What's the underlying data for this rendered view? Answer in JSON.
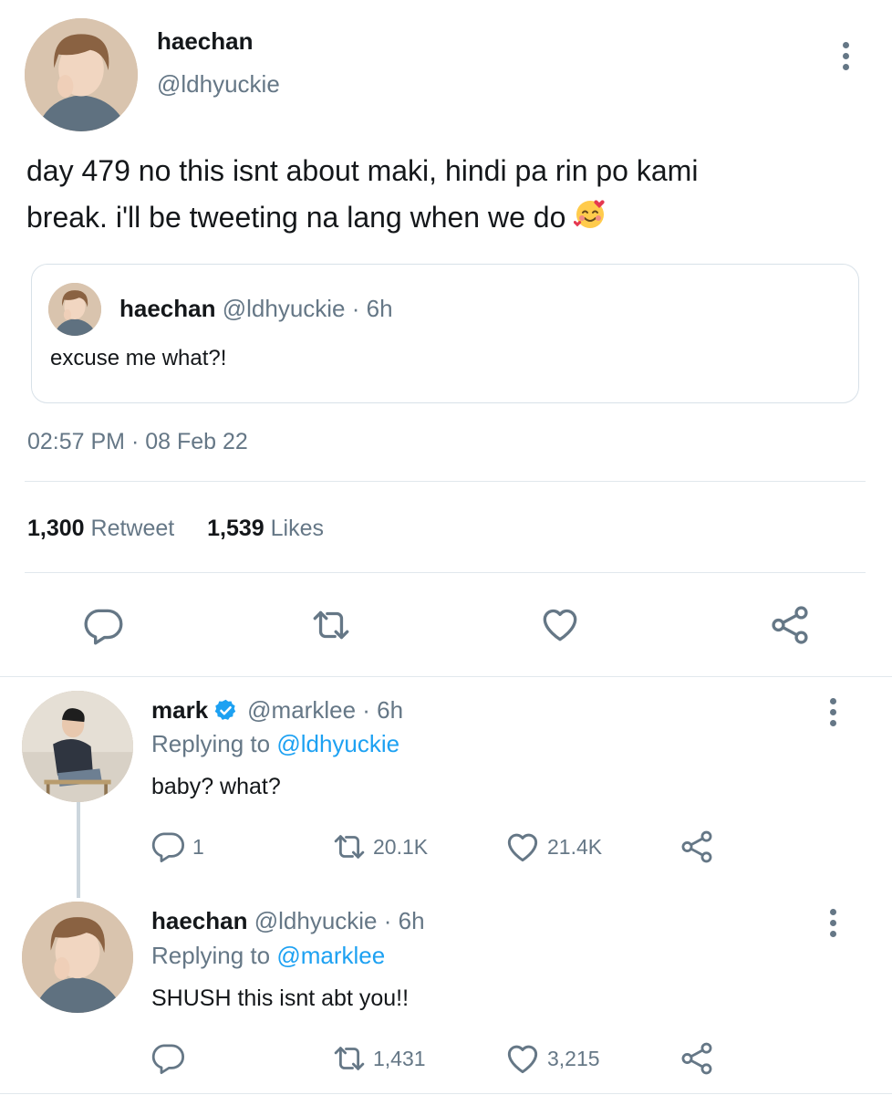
{
  "main_tweet": {
    "author_name": "haechan",
    "author_handle": "@ldhyuckie",
    "text": "day 479 no this isnt about maki, hindi pa rin po kami break. i'll be tweeting na lang when we do 🥰",
    "text_line1": "day 479 no this isnt about maki, hindi pa rin po kami",
    "text_line2": "break. i'll be tweeting na lang when we do",
    "emoji": "smiling-face-with-hearts",
    "quoted": {
      "author_name": "haechan",
      "author_handle_time": "@ldhyuckie · 6h",
      "text": "excuse me what?!"
    },
    "timestamp": "02:57 PM · 08 Feb 22",
    "stats": {
      "retweet_count": "1,300",
      "retweet_label": "Retweet",
      "like_count": "1,539",
      "like_label": "Likes"
    },
    "actions": [
      "reply-icon",
      "retweet-icon",
      "like-icon",
      "share-icon"
    ]
  },
  "replies": [
    {
      "author_name": "mark",
      "verified": true,
      "handle_time": "@marklee · 6h",
      "replying_prefix": "Replying to",
      "replying_to": "@ldhyuckie",
      "text": "baby? what?",
      "reply_count": "1",
      "retweet_count": "20.1K",
      "like_count": "21.4K"
    },
    {
      "author_name": "haechan",
      "verified": false,
      "handle_time": "@ldhyuckie · 6h",
      "replying_prefix": "Replying to",
      "replying_to": "@marklee",
      "text": "SHUSH this isnt abt you!!",
      "reply_count": "",
      "retweet_count": "1,431",
      "like_count": "3,215"
    }
  ],
  "colors": {
    "accent": "#1da1f2",
    "muted": "#657786",
    "text": "#14171a",
    "divider": "#e1e8ed"
  }
}
